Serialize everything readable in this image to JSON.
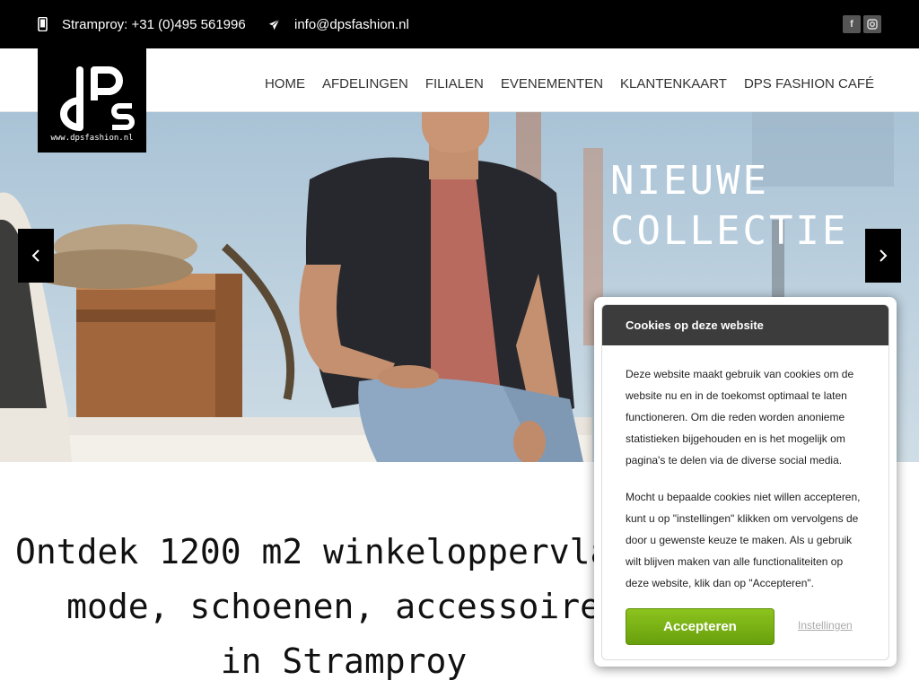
{
  "topbar": {
    "phone": "Stramproy: +31 (0)495 561996",
    "email": "info@dpsfashion.nl",
    "phone_icon": "mobile-phone-icon",
    "email_icon": "paper-plane-icon",
    "social": [
      {
        "icon": "facebook-icon",
        "glyph": "f"
      },
      {
        "icon": "instagram-icon",
        "glyph": "◘"
      }
    ]
  },
  "logo": {
    "mark": "dPs",
    "url": "www.dpsfashion.nl"
  },
  "nav": {
    "items": [
      "HOME",
      "AFDELINGEN",
      "FILIALEN",
      "EVENEMENTEN",
      "KLANTENKAART",
      "DPS FASHION CAFÉ"
    ]
  },
  "hero": {
    "heading_line1": "NIEUWE",
    "heading_line2": "COLLECTIE",
    "prev_icon": "chevron-left-icon",
    "next_icon": "chevron-right-icon"
  },
  "intro": {
    "line1": "Ontdek 1200 m2 winkeloppervlakte",
    "line2": "mode, schoenen, accessoires",
    "line3": "in Stramproy"
  },
  "cookie": {
    "title": "Cookies op deze website",
    "paragraph1": "Deze website maakt gebruik van cookies om de website nu en in de toekomst optimaal te laten functioneren. Om die reden worden anonieme statistieken bijgehouden en is het mogelijk om pagina's te delen via de diverse social media.",
    "paragraph2": "Mocht u bepaalde cookies niet willen accepteren, kunt u op \"instellingen\" klikken om vervolgens de door u gewenste keuze te maken. Als u gebruik wilt blijven maken van alle functionaliteiten op deze website, klik dan op \"Accepteren\".",
    "accept_label": "Accepteren",
    "settings_label": "Instellingen"
  },
  "colors": {
    "topbar": "#000000",
    "accept_green": "#7ab317",
    "cookie_header": "#3c3c3c"
  }
}
